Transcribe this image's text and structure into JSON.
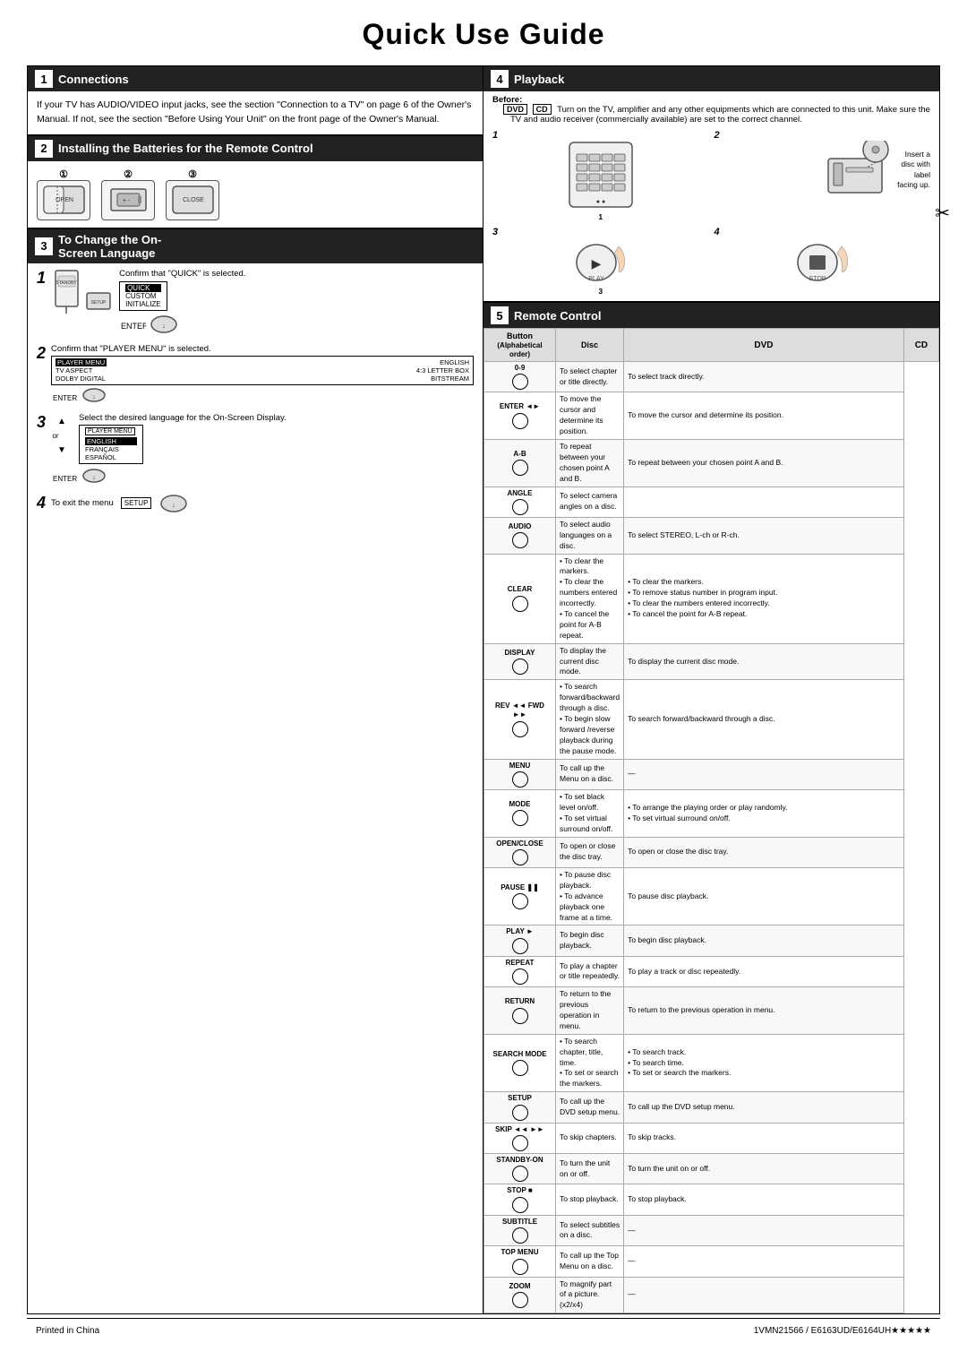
{
  "page": {
    "title": "Quick Use Guide",
    "footer": {
      "left": "Printed in China",
      "right": "1VMN21566 / E6163UD/E6164UH★★★★★"
    }
  },
  "sections": {
    "connections": {
      "num": "1",
      "title": "Connections",
      "body": "If your TV has AUDIO/VIDEO input jacks, see the section \"Connection to a TV\" on page 6 of the Owner's Manual. If not, see the section \"Before Using Your Unit\" on the front page of the Owner's Manual."
    },
    "batteries": {
      "num": "2",
      "title": "Installing the Batteries for the Remote Control",
      "steps": [
        "①",
        "②",
        "③"
      ]
    },
    "onscreen": {
      "num": "3",
      "title": "To Change the On-Screen Language",
      "steps": [
        {
          "num": "1",
          "desc": "Confirm that \"QUICK\" is selected.",
          "menu": [
            "QUICK",
            "CUSTOM",
            "INITIALIZE"
          ],
          "selected": "QUICK"
        },
        {
          "num": "2",
          "desc": "Confirm that \"PLAYER MENU\" is selected.",
          "menu": [
            "PLAYER MENU  ENGLISH",
            "TV ASPECT  4:3 LETTER BOX",
            "DOLBY DIGITAL  BITSTREAM"
          ],
          "selected": "PLAYER MENU"
        },
        {
          "num": "3",
          "desc": "Select the desired language for the On-Screen Display.",
          "menu": [
            "ENGLISH",
            "FRANÇAIS",
            "ESPAÑOL"
          ],
          "selected": "ENGLISH"
        },
        {
          "num": "4",
          "desc": "To exit the menu"
        }
      ]
    },
    "playback": {
      "num": "4",
      "title": "Playback",
      "before_label": "Before:",
      "before_note": "Turn on the TV, amplifier and any other equipments which are connected to this unit. Make sure the TV and audio receiver (commercially available) are set to the correct channel.",
      "steps": [
        {
          "num": "1",
          "desc": ""
        },
        {
          "num": "2",
          "desc": "Insert a disc with label facing up."
        },
        {
          "num": "3",
          "desc": ""
        },
        {
          "num": "4",
          "desc": ""
        }
      ]
    },
    "remote": {
      "num": "5",
      "title": "Remote Control",
      "table_headers": [
        "Button\n(Alphabetical order)",
        "Disc\nDVD",
        "CD"
      ],
      "rows": [
        {
          "button": "0-9",
          "dvd": "To select chapter or title directly.",
          "cd": "To select track directly."
        },
        {
          "button": "ENTER ◄►",
          "dvd": "To move the cursor and determine its position.",
          "cd": "To move the cursor and determine its position."
        },
        {
          "button": "A-B",
          "dvd": "To repeat between your chosen point A and B.",
          "cd": "To repeat between your chosen point A and B."
        },
        {
          "button": "ANGLE",
          "dvd": "To select camera angles on a disc.",
          "cd": ""
        },
        {
          "button": "AUDIO",
          "dvd": "To select audio languages on a disc.",
          "cd": "To select STEREO, L-ch or R-ch."
        },
        {
          "button": "CLEAR",
          "dvd": "• To clear the markers.\n• To clear the numbers entered incorrectly.\n• To cancel the point for A-B repeat.",
          "cd": "• To clear the markers.\n• To remove status number in program input.\n• To clear the numbers entered incorrectly.\n• To cancel the point for A-B repeat."
        },
        {
          "button": "DISPLAY",
          "dvd": "To display the current disc mode.",
          "cd": "To display the current disc mode."
        },
        {
          "button": "REV ◄◄  FWD ►►",
          "dvd": "• To search forward/backward through a disc.\n• To begin slow forward /reverse playback during the pause mode.",
          "cd": "To search forward/backward through a disc."
        },
        {
          "button": "MENU",
          "dvd": "To call up the Menu on a disc.",
          "cd": "—"
        },
        {
          "button": "MODE",
          "dvd": "• To set black level on/off.\n• To set virtual surround on/off.",
          "cd": "• To arrange the playing order or play randomly.\n• To set virtual surround on/off."
        },
        {
          "button": "OPEN/CLOSE",
          "dvd": "To open or close the disc tray.",
          "cd": "To open or close the disc tray."
        },
        {
          "button": "PAUSE ❚❚",
          "dvd": "• To pause disc playback.\n• To advance playback one frame at a time.",
          "cd": "To pause disc playback."
        },
        {
          "button": "PLAY ►",
          "dvd": "To begin disc playback.",
          "cd": "To begin disc playback."
        },
        {
          "button": "REPEAT",
          "dvd": "To play a chapter or title repeatedly.",
          "cd": "To play a track or disc repeatedly."
        },
        {
          "button": "RETURN",
          "dvd": "To return to the previous operation in menu.",
          "cd": "To return to the previous operation in menu."
        },
        {
          "button": "SEARCH MODE",
          "dvd": "• To search chapter, title, time.\n• To set or search the markers.",
          "cd": "• To search track.\n• To search time.\n• To set or search the markers."
        },
        {
          "button": "SETUP",
          "dvd": "To call up the DVD setup menu.",
          "cd": "To call up the DVD setup menu."
        },
        {
          "button": "SKIP ◄◄  ►►",
          "dvd": "To skip chapters.",
          "cd": "To skip tracks."
        },
        {
          "button": "STANDBY-ON",
          "dvd": "To turn the unit on or off.",
          "cd": "To turn the unit on or off."
        },
        {
          "button": "STOP ■",
          "dvd": "To stop playback.",
          "cd": "To stop playback."
        },
        {
          "button": "SUBTITLE",
          "dvd": "To select subtitles on a disc.",
          "cd": "—"
        },
        {
          "button": "TOP MENU",
          "dvd": "To call up the Top Menu on a disc.",
          "cd": "—"
        },
        {
          "button": "ZOOM",
          "dvd": "To magnify part of a picture. (x2/x4)",
          "cd": "—"
        }
      ]
    }
  }
}
